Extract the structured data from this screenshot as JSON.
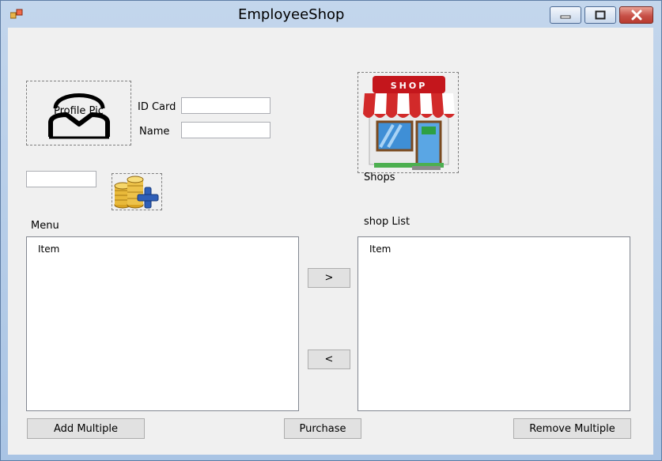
{
  "window": {
    "title": "EmployeeShop",
    "controls": {
      "minimize": "minimize",
      "maximize": "maximize",
      "close": "close"
    }
  },
  "profile": {
    "picture_label": "Profile Pic",
    "id_card_label": "ID Card",
    "id_card_value": "",
    "name_label": "Name",
    "name_value": ""
  },
  "coins": {
    "amount_value": "",
    "add_coins_icon": "coins-plus-icon"
  },
  "shop": {
    "icon": "shop-storefront-icon",
    "shop_sign": "SHOP",
    "label": "Shops"
  },
  "menu": {
    "label": "Menu",
    "items": [
      "Item"
    ]
  },
  "shop_list": {
    "label": "shop List",
    "items": [
      "Item"
    ]
  },
  "transfer": {
    "move_right_label": ">",
    "move_left_label": "<"
  },
  "actions": {
    "add_multiple_label": "Add Multiple",
    "purchase_label": "Purchase",
    "remove_multiple_label": "Remove Multiple"
  },
  "colors": {
    "client_bg": "#f0f0f0",
    "title_bar": "#b9d1ea",
    "close_button": "#c75047",
    "awning_red": "#d22a2a"
  }
}
